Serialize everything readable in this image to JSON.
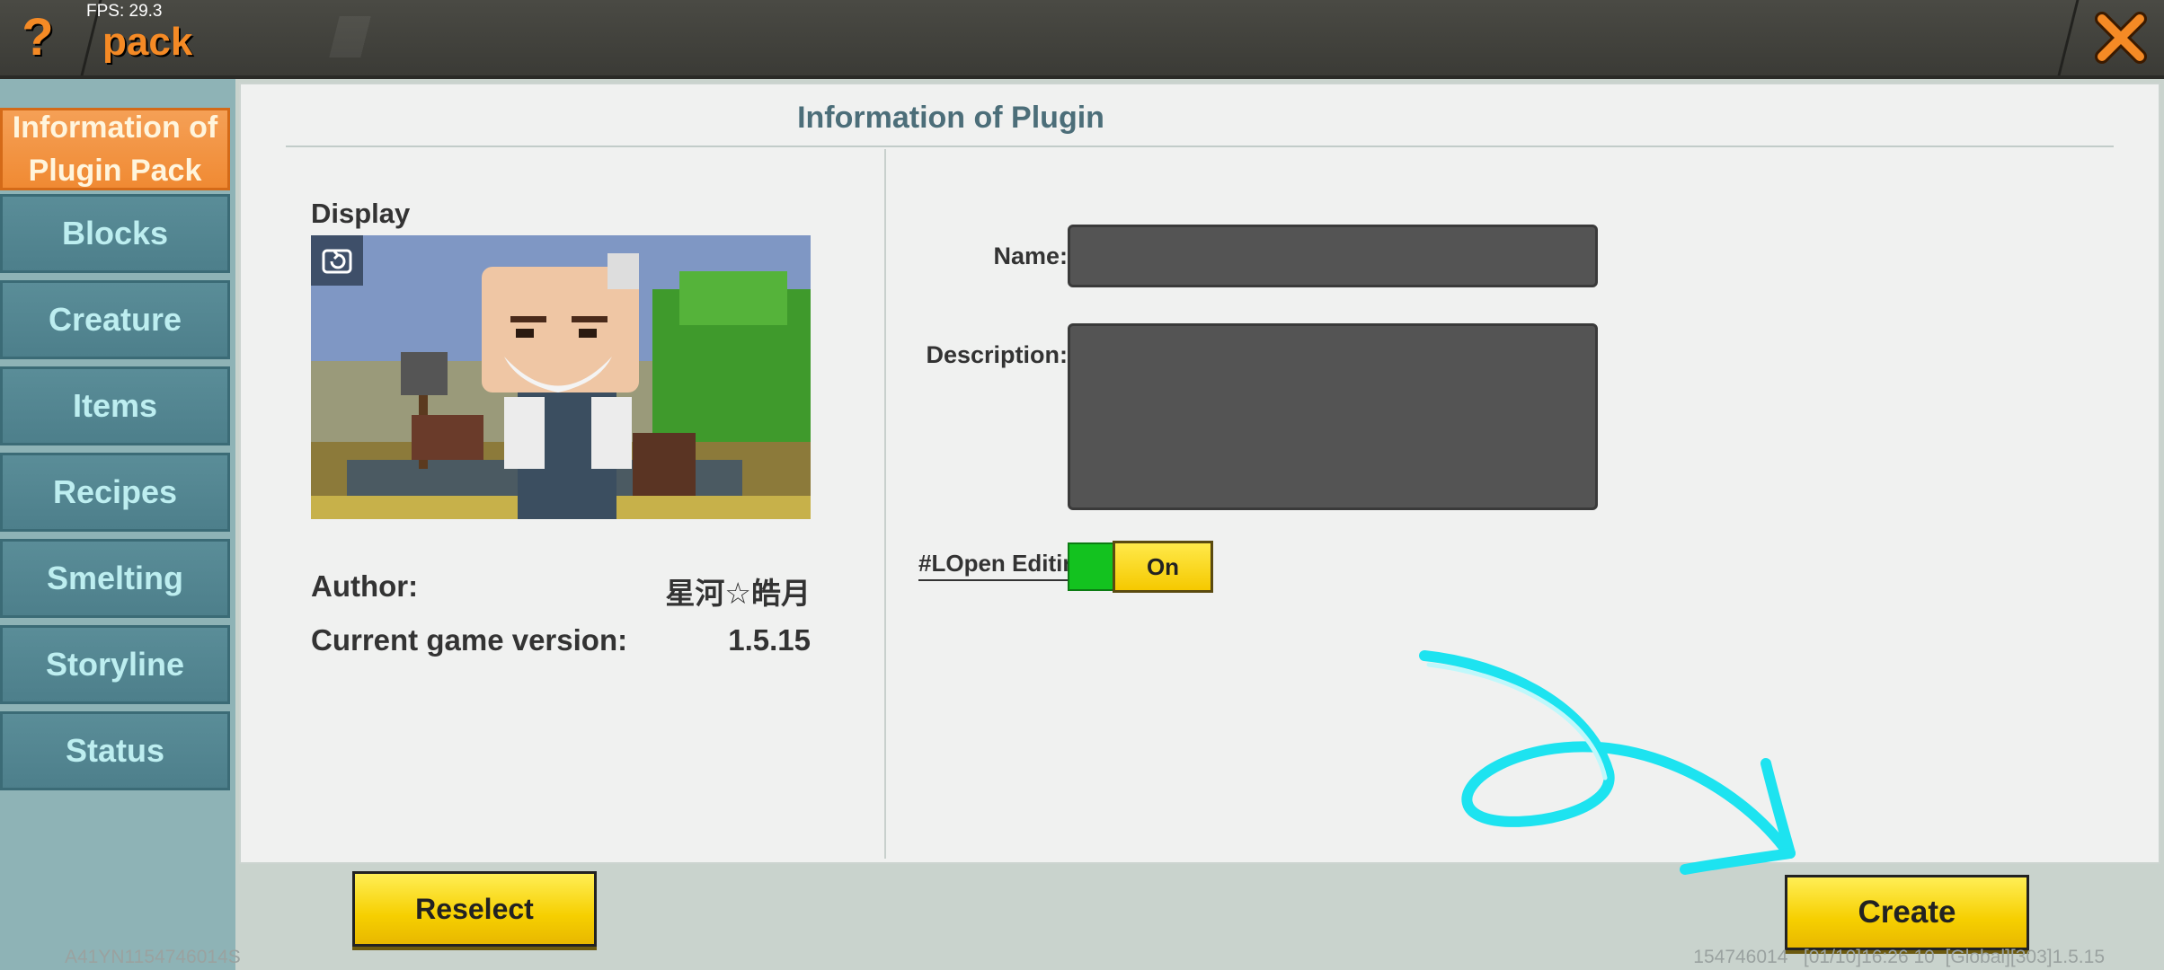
{
  "header": {
    "fps_text": "FPS: 29.3",
    "title": "pack",
    "help_icon": "question-mark-icon",
    "close_icon": "close-icon"
  },
  "sidebar": {
    "items": [
      {
        "label": "Information of Plugin Pack",
        "active": true
      },
      {
        "label": "Blocks"
      },
      {
        "label": "Creature"
      },
      {
        "label": "Items"
      },
      {
        "label": "Recipes"
      },
      {
        "label": "Smelting"
      },
      {
        "label": "Storyline"
      },
      {
        "label": "Status"
      }
    ]
  },
  "main": {
    "title": "Information of Plugin",
    "display_label": "Display",
    "refresh_icon": "refresh-icon",
    "author_label": "Author:",
    "author_value": "星河☆皓月",
    "version_label": "Current game version:",
    "version_value": "1.5.15",
    "form": {
      "name_label": "Name:",
      "name_value": "",
      "description_label": "Description:",
      "description_value": "",
      "open_editing_label": "#LOpen Editing",
      "open_editing_state": "On"
    }
  },
  "buttons": {
    "reselect": "Reselect",
    "create": "Create"
  },
  "footer": {
    "left": "A41YN1154746014S",
    "right": "154746014   [01/10]16:26 10  [Global][303]1.5.15"
  },
  "colors": {
    "accent_orange": "#f58a25",
    "sidebar_tab": "#5a8d98",
    "button_yellow": "#f6cf00",
    "toggle_green": "#13c21f",
    "annotation_cyan": "#1de3f0"
  }
}
